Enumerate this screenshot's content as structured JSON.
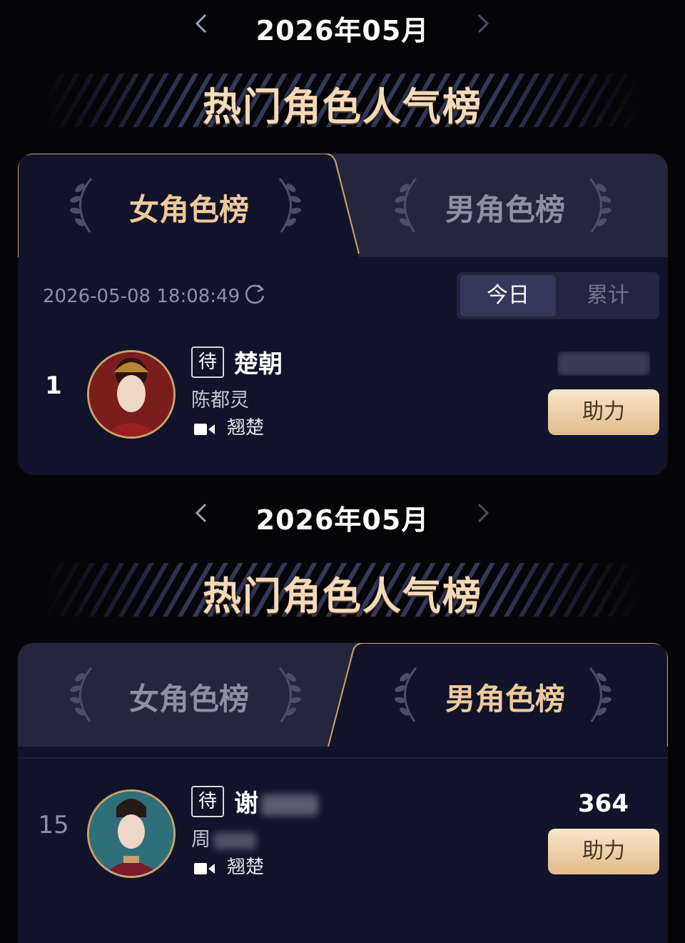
{
  "section_one": {
    "month_label": "2026年05月",
    "banner_title": "热门角色人气榜",
    "tabs": [
      {
        "label": "女角色榜",
        "active": true
      },
      {
        "label": "男角色榜",
        "active": false
      }
    ],
    "timestamp": "2026-05-08 18:08:49",
    "period_toggle": [
      {
        "label": "今日",
        "selected": true
      },
      {
        "label": "累计",
        "selected": false
      }
    ],
    "entry": {
      "rank": "1",
      "status_badge": "待",
      "character_name": "楚朝",
      "actor_name": "陈都灵",
      "drama_name": "翘楚",
      "votes_obscured": "",
      "boost_label": "助力"
    }
  },
  "section_two": {
    "month_label": "2026年05月",
    "banner_title": "热门角色人气榜",
    "tabs": [
      {
        "label": "女角色榜",
        "active": false
      },
      {
        "label": "男角色榜",
        "active": true
      }
    ],
    "entry": {
      "rank": "15",
      "status_badge": "待",
      "character_name": "谢",
      "actor_name": "周",
      "drama_name": "翘楚",
      "votes": "364",
      "boost_label": "助力"
    }
  },
  "colors": {
    "background": "#050508",
    "card": "#11132a",
    "tab_inactive": "#23263d",
    "gold_text": "#f0c99a",
    "boost_button": "#e8c497"
  },
  "icons": [
    "chevron-left-icon",
    "chevron-right-icon",
    "laurel-wreath-icon",
    "refresh-icon",
    "video-camera-icon"
  ]
}
